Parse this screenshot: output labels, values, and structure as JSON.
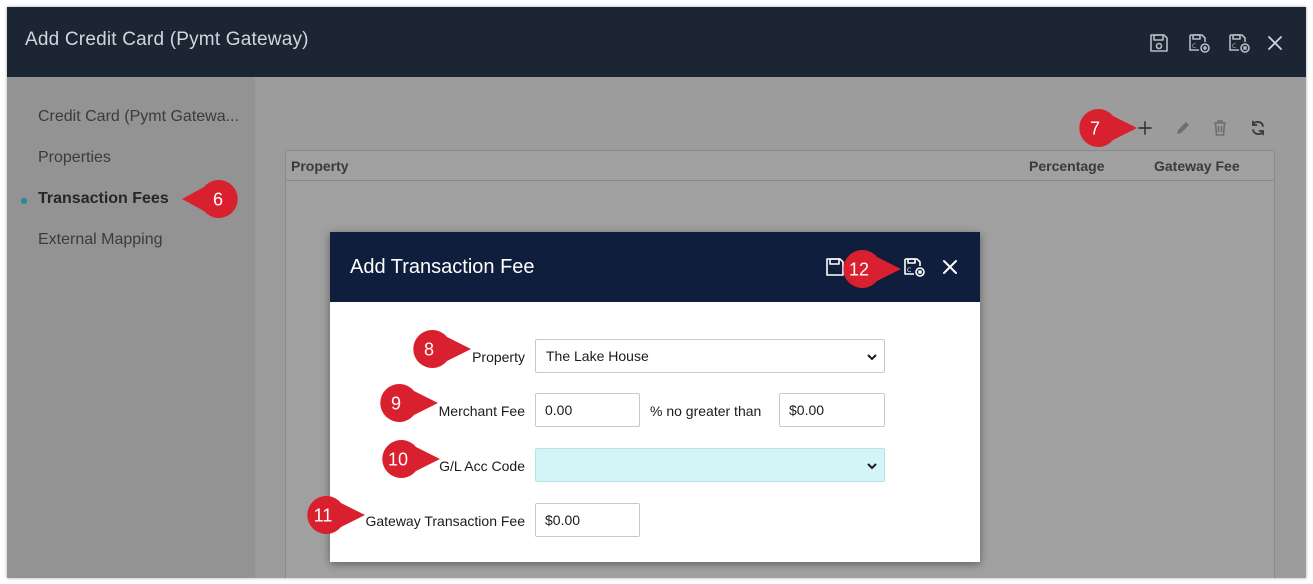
{
  "window": {
    "title": "Add Credit Card (Pymt Gateway)",
    "toolbar_icons": [
      "save-icon",
      "save-add-icon",
      "save-close-icon",
      "close-icon"
    ]
  },
  "sidebar": {
    "items": [
      {
        "label": "Credit Card (Pymt Gatewa..."
      },
      {
        "label": "Properties"
      },
      {
        "label": "Transaction Fees"
      },
      {
        "label": "External Mapping"
      }
    ],
    "active_index": 2
  },
  "grid": {
    "toolbar_icons": [
      "plus-icon",
      "pencil-icon",
      "trash-icon",
      "refresh-icon"
    ],
    "columns": [
      "Property",
      "Percentage",
      "Gateway Fee"
    ],
    "rows": []
  },
  "modal": {
    "title": "Add Transaction Fee",
    "fields": {
      "property": {
        "label": "Property",
        "value": "The Lake House"
      },
      "merchant_fee": {
        "label": "Merchant Fee",
        "value": "0.00",
        "between_text": "% no greater than",
        "max_value": "$0.00"
      },
      "gl_acc_code": {
        "label": "G/L Acc Code",
        "value": ""
      },
      "gateway_fee": {
        "label": "Gateway Transaction Fee",
        "value": "$0.00"
      }
    }
  },
  "callouts": [
    "6",
    "7",
    "8",
    "9",
    "10",
    "11",
    "12"
  ],
  "colors": {
    "titlebar": "#1c2533",
    "modal_header": "#0f1e3c",
    "callout_red": "#d8202e",
    "gl_select_bg": "#d4f5f8",
    "active_dot": "#1f8b9e"
  }
}
